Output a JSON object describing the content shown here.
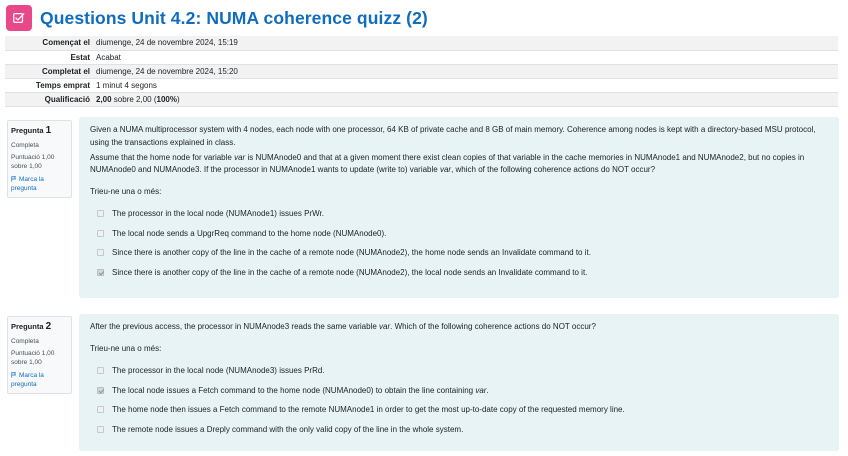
{
  "header": {
    "title": "Questions Unit 4.2: NUMA coherence quizz (2)",
    "icon": "quiz-icon",
    "icon_color": "#e8488a",
    "title_color": "#0f6cbf"
  },
  "summary": [
    {
      "label": "Començat el",
      "value": "diumenge, 24 de novembre 2024, 15:19"
    },
    {
      "label": "Estat",
      "value": "Acabat"
    },
    {
      "label": "Completat el",
      "value": "diumenge, 24 de novembre 2024, 15:20"
    },
    {
      "label": "Temps emprat",
      "value": "1 minut 4 segons"
    },
    {
      "label": "Qualificació",
      "value_bold": "2,00",
      "value_rest": " sobre 2,00 (",
      "value_pct": "100%",
      "value_end": ")"
    }
  ],
  "questions": [
    {
      "label": "Pregunta",
      "number": "1",
      "state": "Completa",
      "grade": "Puntuació 1,00 sobre 1,00",
      "flag_label": "Marca la pregunta",
      "text_p1": "Given a NUMA multiprocessor system with 4 nodes, each node with one processor, 64 KB of private cache and 8 GB of main memory. Coherence among nodes is kept with a directory-based MSU protocol, using the transactions explained in class.",
      "text_p2_a": "Assume that the home node for variable ",
      "text_p2_var1": "var",
      "text_p2_b": " is NUMAnode0 and that at a given moment there exist clean copies of that variable in the cache memories in NUMAnode1 and NUMAnode2, but no copies in NUMAnode0 and NUMAnode3. If the processor in NUMAnode1 wants to update (write to) variable ",
      "text_p2_var2": "var",
      "text_p2_c": ", which of the following coherence actions do NOT occur?",
      "prompt": "Trieu-ne una o més:",
      "answers": [
        {
          "text": "The processor in the local node (NUMAnode1) issues PrWr.",
          "checked": false
        },
        {
          "text": "The local node sends a UpgrReq command to the home node (NUMAnode0).",
          "checked": false
        },
        {
          "text": "Since there is another copy of the line in the cache of a remote node (NUMAnode2), the home node sends an Invalidate command to it.",
          "checked": false
        },
        {
          "text": "Since there is another copy of the line in the cache of a remote node (NUMAnode2), the local node sends an Invalidate command to it.",
          "checked": true
        }
      ]
    },
    {
      "label": "Pregunta",
      "number": "2",
      "state": "Completa",
      "grade": "Puntuació 1,00 sobre 1,00",
      "flag_label": "Marca la pregunta",
      "text_a": "After the previous access, the processor in NUMAnode3 reads the same variable ",
      "text_var": "var",
      "text_b": ". Which of the following coherence actions do NOT occur?",
      "prompt": "Trieu-ne una o més:",
      "answers": [
        {
          "text": "The processor in the local node (NUMAnode3) issues PrRd.",
          "checked": false
        },
        {
          "text_a": "The local node issues a Fetch command to the home node (NUMAnode0) to obtain the line containing ",
          "text_var": "var",
          "text_b": ".",
          "checked": true
        },
        {
          "text": "The home node then issues a Fetch command to the remote NUMAnode1 in order to get the most up-to-date copy of the requested memory line.",
          "checked": false
        },
        {
          "text": "The remote node issues a Dreply command with the only valid copy of the line in the whole system.",
          "checked": false
        }
      ]
    }
  ]
}
